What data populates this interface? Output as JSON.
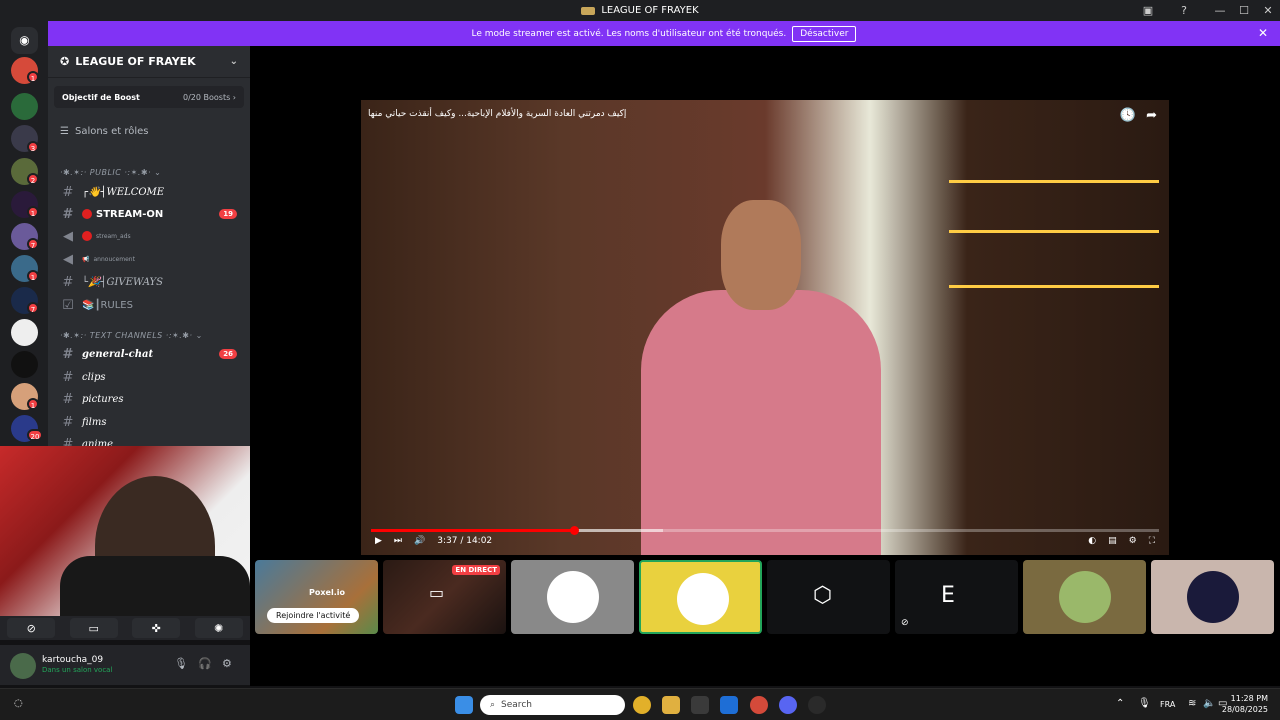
{
  "window": {
    "title": "LEAGUE OF FRAYEK",
    "minimize": "—",
    "maximize": "☐",
    "close": "✕"
  },
  "banner": {
    "text": "Le mode streamer est activé. Les noms d'utilisateur ont été tronqués.",
    "button": "Désactiver",
    "close": "✕"
  },
  "servers": {
    "badges": [
      "1",
      "3",
      "2",
      "1",
      "7",
      "1",
      "7",
      "1",
      "20"
    ]
  },
  "sidebar": {
    "server_name": "LEAGUE OF FRAYEK",
    "boost_label": "Objectif de Boost",
    "boost_count": "0/20 Boosts ›",
    "roles_label": "Salons et rôles",
    "cat_public": "·✱.✶:· PUBLIC ·:✶.✱· ⌄",
    "cat_text": "·✱.✶:· TEXT CHANNELS ·:✶.✱· ⌄",
    "channels": [
      {
        "name": "┌👋┤WELCOME",
        "badge": ""
      },
      {
        "name": "STREAM-ON",
        "badge": "19"
      },
      {
        "name": "stream_ads",
        "badge": ""
      },
      {
        "name": "annoucement",
        "badge": ""
      },
      {
        "name": "└🎉┤GIVEWAYS",
        "badge": ""
      },
      {
        "name": "📚┃RULES",
        "badge": ""
      },
      {
        "name": "general-chat",
        "badge": "26"
      },
      {
        "name": "clips",
        "badge": ""
      },
      {
        "name": "pictures",
        "badge": ""
      },
      {
        "name": "films",
        "badge": ""
      },
      {
        "name": "anime",
        "badge": ""
      }
    ]
  },
  "user": {
    "name": "kartoucha_09",
    "status": "Dans un salon vocal"
  },
  "video": {
    "title": "إكيف دمرتني العادة السرية والأفلام الإباحية... وكيف أنقذت حياتي منها",
    "time": "3:37 / 14:02",
    "progress": 0.258,
    "buffered": 0.37
  },
  "activities": {
    "tile0_label": "Poxel.io",
    "tile0_join": "Rejoindre l'activité",
    "tile1_live": "EN DIRECT"
  },
  "taskbar": {
    "search_placeholder": "Search",
    "lang": "FRA",
    "time": "11:28 PM",
    "date": "28/08/2025"
  },
  "colors": {
    "accent": "#8133f5",
    "danger": "#f23f43",
    "online": "#23a55a"
  }
}
